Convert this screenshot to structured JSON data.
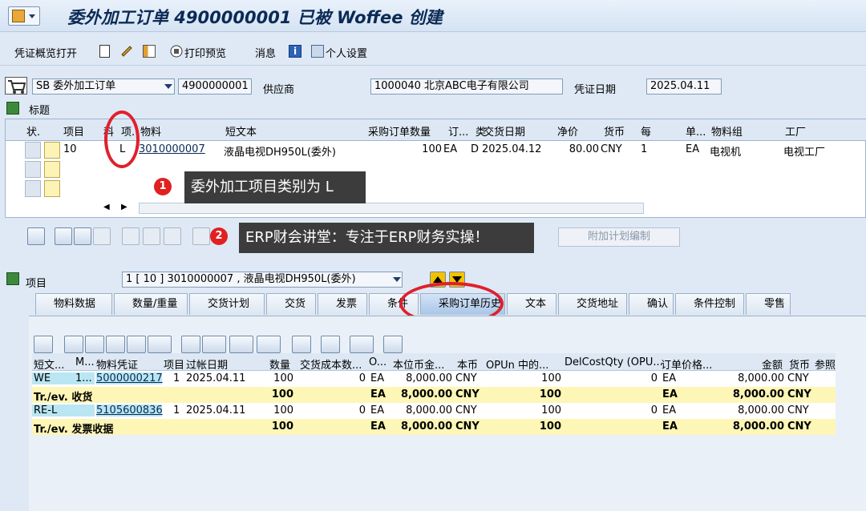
{
  "window": {
    "title": "委外加工订单 4900000001 已被 Woffee 创建"
  },
  "toolbar": {
    "overview": "凭证概览打开",
    "print_preview": "打印预览",
    "messages": "消息",
    "personal_settings": "个人设置"
  },
  "header": {
    "doc_type": "SB 委外加工订单",
    "doc_number": "4900000001",
    "vendor_label": "供应商",
    "vendor_value": "1000040 北京ABC电子有限公司",
    "doc_date_label": "凭证日期",
    "doc_date_value": "2025.04.11",
    "header_label": "标题"
  },
  "item_grid": {
    "columns": [
      "状.",
      "项目",
      "科",
      "项.",
      "物料",
      "短文本",
      "采购订单数量",
      "订...",
      "类",
      "交货日期",
      "净价",
      "货币",
      "每",
      "单...",
      "物料组",
      "工厂"
    ],
    "rows": [
      {
        "item": "10",
        "cat": "L",
        "material": "3010000007",
        "short_text": "液晶电视DH950L(委外)",
        "qty": "100",
        "uom": "EA",
        "d": "D",
        "delivery": "2025.04.12",
        "price": "80.00",
        "currency": "CNY",
        "per": "1",
        "unit": "EA",
        "mat_group": "电视机",
        "plant": "电视工厂"
      }
    ]
  },
  "annotations": {
    "a1_num": "1",
    "a1_text": "委外加工项目类别为 L",
    "a2_num": "2",
    "a2_text": "ERP财会讲堂：专注于ERP财务实操！"
  },
  "plan_button": "附加计划编制",
  "item_section": {
    "label": "项目",
    "selected": "1 [ 10 ] 3010000007 , 液晶电视DH950L(委外)"
  },
  "tabs": [
    "物料数据",
    "数量/重量",
    "交货计划",
    "交货",
    "发票",
    "条件",
    "采购订单历史",
    "文本",
    "交货地址",
    "确认",
    "条件控制",
    "零售"
  ],
  "history": {
    "columns": [
      "短文...",
      "M...",
      "物料凭证",
      "项目",
      "过帐日期",
      "数量",
      "交货成本数...",
      "O...",
      "本位币金...",
      "本币",
      "OPUn 中的...",
      "DelCostQty (OPU...",
      "订单价格...",
      "金额",
      "货币",
      "参照"
    ],
    "rows": [
      {
        "type": "WE",
        "m": "1...",
        "doc": "5000000217",
        "item": "1",
        "date": "2025.04.11",
        "qty": "100",
        "dc": "0",
        "o": "EA",
        "lc_amt": "8,000.00",
        "lc": "CNY",
        "opun": "100",
        "delc": "0",
        "opu": "EA",
        "amt": "8,000.00",
        "cur": "CNY",
        "sum": false
      },
      {
        "type": "Tr./ev. 收货",
        "m": "",
        "doc": "",
        "item": "",
        "date": "",
        "qty": "100",
        "dc": "",
        "o": "EA",
        "lc_amt": "8,000.00",
        "lc": "CNY",
        "opun": "100",
        "delc": "",
        "opu": "EA",
        "amt": "8,000.00",
        "cur": "CNY",
        "sum": true
      },
      {
        "type": "RE-L",
        "m": "",
        "doc": "5105600836",
        "item": "1",
        "date": "2025.04.11",
        "qty": "100",
        "dc": "0",
        "o": "EA",
        "lc_amt": "8,000.00",
        "lc": "CNY",
        "opun": "100",
        "delc": "0",
        "opu": "EA",
        "amt": "8,000.00",
        "cur": "CNY",
        "sum": false
      },
      {
        "type": "Tr./ev. 发票收据",
        "m": "",
        "doc": "",
        "item": "",
        "date": "",
        "qty": "100",
        "dc": "",
        "o": "EA",
        "lc_amt": "8,000.00",
        "lc": "CNY",
        "opun": "100",
        "delc": "",
        "opu": "EA",
        "amt": "8,000.00",
        "cur": "CNY",
        "sum": true
      }
    ]
  },
  "colors": {
    "accent": "#e0202c",
    "sum_row": "#fdf6b6",
    "link": "#0b2a55"
  }
}
